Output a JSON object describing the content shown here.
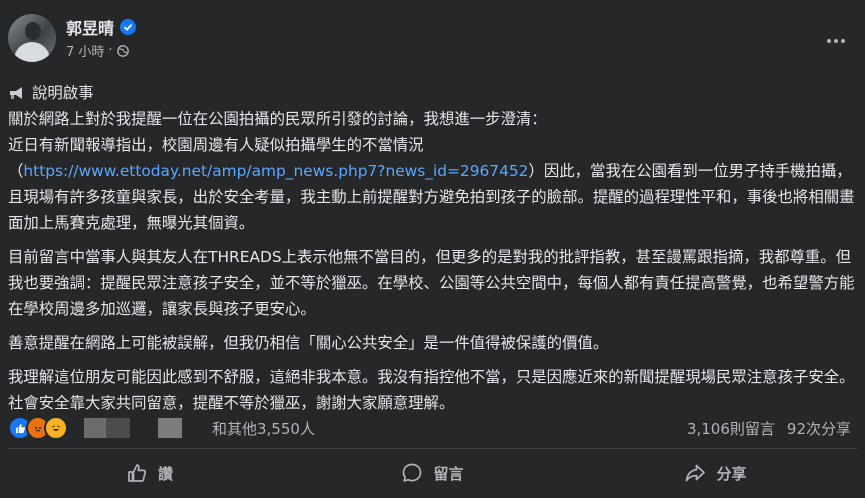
{
  "post": {
    "author": "郭昱晴",
    "time": "7 小時",
    "separator": "·",
    "heading": "說明啟事",
    "para1_line1": "關於網路上對於我提醒一位在公園拍攝的民眾所引發的討論，我想進一步澄清：",
    "para1_line2": "近日有新聞報導指出，校園周邊有人疑似拍攝學生的不當情況",
    "para1_paren_open": "（",
    "link": "https://www.ettoday.net/amp/amp_news.php7?news_id=2967452",
    "para1_after_link": "）因此，當我在公園看到一位男子持手機拍攝，且現場有許多孩童與家長，出於安全考量，我主動上前提醒對方避免拍到孩子的臉部。提醒的過程理性平和，事後也將相關畫面加上馬賽克處理，無曝光其個資。",
    "para2": "目前留言中當事人與其友人在THREADS上表示他無不當目的，但更多的是對我的批評指教，甚至謾罵跟指摘，我都尊重。但我也要強調：提醒民眾注意孩子安全，並不等於獵巫。在學校、公園等公共空間中，每個人都有責任提高警覺，也希望警方能在學校周邊多加巡邏，讓家長與孩子更安心。",
    "para3": "善意提醒在網路上可能被誤解，但我仍相信「關心公共安全」是一件值得被保護的價值。",
    "para4": "我理解這位朋友可能因此感到不舒服，這絕非我本意。我沒有指控他不當，只是因應近來的新聞提醒現場民眾注意孩子安全。社會安全靠大家共同留意，提醒不等於獵巫，謝謝大家願意理解。"
  },
  "stats": {
    "others": "和其他3,550人",
    "comments": "3,106則留言",
    "shares": "92次分享"
  },
  "actions": {
    "like": "讚",
    "comment": "留言",
    "share": "分享"
  },
  "icons": [
    "verified-badge-icon",
    "globe-icon",
    "more-options-icon",
    "megaphone-icon",
    "like-reaction-icon",
    "angry-reaction-icon",
    "haha-reaction-icon",
    "thumbs-up-icon",
    "comment-bubble-icon",
    "share-arrow-icon"
  ],
  "colors": {
    "background": "#252728",
    "text": "#e4e6eb",
    "secondary": "#b0b3b8",
    "link": "#5aa7ff",
    "verified": "#1877f2"
  }
}
